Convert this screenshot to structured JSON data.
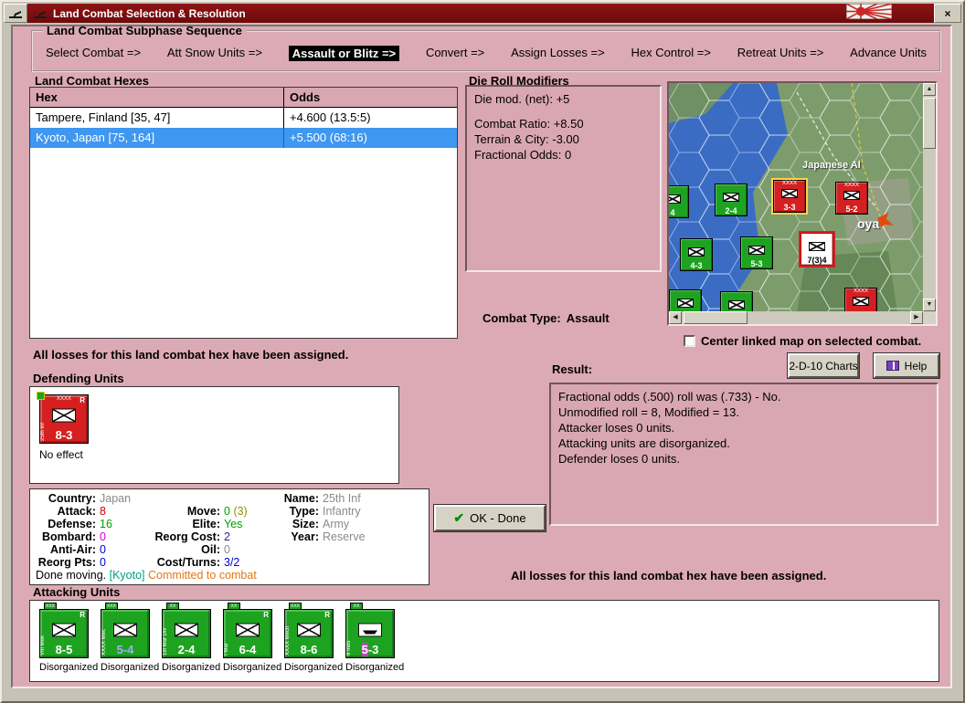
{
  "colors": {
    "client_bg": "#dcaab4",
    "panel_pink": "#d9a7b1",
    "selection_blue": "#3e97f0",
    "counter_green": "#1ea321",
    "counter_red": "#d42020",
    "button_face": "#d6d2c6"
  },
  "window": {
    "title": "Land Combat Selection & Resolution"
  },
  "icons": {
    "up": "▲",
    "down": "▼",
    "left": "◀",
    "right": "▶",
    "close": "×",
    "check": "✔"
  },
  "sequence": {
    "title": "Land Combat Subphase Sequence",
    "steps": [
      {
        "label": "Select Combat =>"
      },
      {
        "label": "Att Snow Units =>"
      },
      {
        "label": "Assault or Blitz =>",
        "active": true
      },
      {
        "label": "Convert =>"
      },
      {
        "label": "Assign Losses =>"
      },
      {
        "label": "Hex Control =>"
      },
      {
        "label": "Retreat Units =>"
      },
      {
        "label": "Advance Units"
      }
    ]
  },
  "hexes": {
    "title": "Land Combat Hexes",
    "columns": [
      "Hex",
      "Odds"
    ],
    "rows": [
      {
        "hex": "Tampere, Finland [35, 47]",
        "odds": "+4.600 (13.5:5)"
      },
      {
        "hex": "Kyoto, Japan [75, 164]",
        "odds": "+5.500 (68:16)",
        "selected": true
      }
    ]
  },
  "modifiers": {
    "title": "Die Roll Modifiers",
    "lines": [
      "Die mod. (net): +5",
      "Combat Ratio: +8.50",
      "Terrain & City: -3.00",
      "Fractional Odds: 0"
    ]
  },
  "combat_type": {
    "label": "Combat Type:",
    "value": "Assault"
  },
  "map": {
    "labels": [
      "Japanese Al",
      "oya"
    ],
    "units": [
      {
        "label": "4"
      },
      {
        "label": "2-4"
      },
      {
        "label": "3-3",
        "size": "XXXX"
      },
      {
        "label": "5-2",
        "size": "XXXX"
      },
      {
        "label": "4-3"
      },
      {
        "label": "5-3"
      },
      {
        "label": "7(3)4"
      },
      {
        "label": ""
      },
      {
        "label": ""
      },
      {
        "label": "",
        "size": "XXXX"
      }
    ],
    "checkbox_label": "Center linked map on selected combat."
  },
  "buttons": {
    "charts": "2-D-10 Charts",
    "help": "Help",
    "ok": "OK - Done"
  },
  "messages": {
    "left": "All losses for this land combat hex have been assigned.",
    "right": "All losses for this land combat hex have been assigned."
  },
  "defending": {
    "title": "Defending Units",
    "unit": {
      "size_top": "XXXX",
      "flag": "R",
      "side_name": "25th Inf",
      "strength": "8-3",
      "status": "No effect"
    }
  },
  "unit_info": {
    "country_label": "Country:",
    "country": "Japan",
    "attack_label": "Attack:",
    "attack": "8",
    "defense_label": "Defense:",
    "defense": "16",
    "bombard_label": "Bombard:",
    "bombard": "0",
    "antiair_label": "Anti-Air:",
    "antiair": "0",
    "reorgpts_label": "Reorg Pts:",
    "reorgpts": "0",
    "move_label": "Move:",
    "move": "0",
    "move_paren": "(3)",
    "elite_label": "Elite:",
    "elite": "Yes",
    "reorgcost_label": "Reorg Cost:",
    "reorgcost": "2",
    "oil_label": "Oil:",
    "oil": "0",
    "costturns_label": "Cost/Turns:",
    "costturns": "3/2",
    "name_label": "Name:",
    "name": "25th Inf",
    "type_label": "Type:",
    "type": "Infantry",
    "size_label": "Size:",
    "size": "Army",
    "year_label": "Year:",
    "year": "Reserve",
    "footer_done": "Done moving.",
    "footer_hex": "[Kyoto]",
    "footer_committed": "Committed to combat"
  },
  "result": {
    "title": "Result:",
    "lines": [
      "Fractional odds (.500) roll was (.733)  - No.",
      "Unmodified roll = 8, Modified = 13.",
      "Attacker loses 0 units.",
      "Attacking units are disorganized.",
      "Defender loses 0 units."
    ]
  },
  "attacking": {
    "title": "Attacking Units",
    "units": [
      {
        "tab": "XXX",
        "side_name": "VIII Mek",
        "flag": "R",
        "strength": "8-5",
        "status": "Disorganized"
      },
      {
        "tab": "XXX",
        "side_name": "XXXX Mec",
        "flag": "",
        "strength": "5-4",
        "status": "Disorganized"
      },
      {
        "tab": "XX",
        "side_name": "1st Mar Div",
        "flag": "",
        "strength": "2-4",
        "status": "Disorganized"
      },
      {
        "tab": "XX",
        "side_name": "I Mar",
        "flag": "R",
        "strength": "6-4",
        "status": "Disorganized"
      },
      {
        "tab": "XXX",
        "side_name": "XXXX Mech",
        "flag": "R",
        "strength": "8-6",
        "status": "Disorganized"
      },
      {
        "tab": "XX",
        "side_name": "8 Inds",
        "flag": "",
        "strength_hl": "5",
        "strength": "-3",
        "status": "Disorganized"
      }
    ]
  }
}
